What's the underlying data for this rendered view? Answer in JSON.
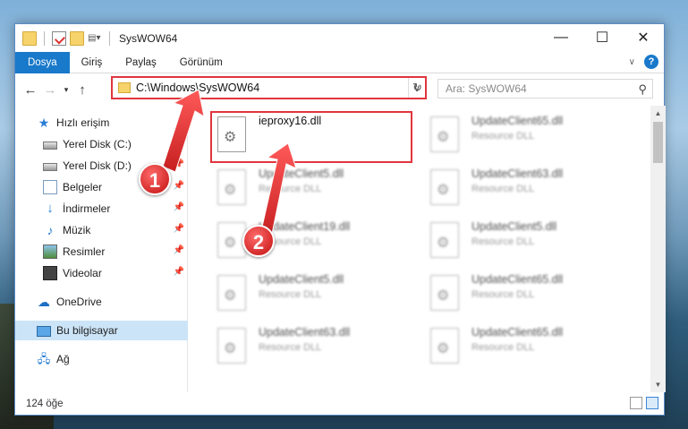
{
  "window": {
    "title": "SysWOW64",
    "controls": {
      "minimize": "—",
      "maximize": "☐",
      "close": "✕"
    }
  },
  "ribbon": {
    "tabs": [
      "Dosya",
      "Giriş",
      "Paylaş",
      "Görünüm"
    ]
  },
  "address": {
    "path": "C:\\Windows\\SysWOW64",
    "search_placeholder": "Ara: SysWOW64"
  },
  "sidebar": {
    "quick_access": "Hızlı erişim",
    "items": [
      {
        "label": "Yerel Disk (C:)",
        "icon": "disk-icon"
      },
      {
        "label": "Yerel Disk (D:)",
        "icon": "disk-icon"
      },
      {
        "label": "Belgeler",
        "icon": "documents-icon"
      },
      {
        "label": "İndirmeler",
        "icon": "download-icon"
      },
      {
        "label": "Müzik",
        "icon": "music-icon"
      },
      {
        "label": "Resimler",
        "icon": "pictures-icon"
      },
      {
        "label": "Videolar",
        "icon": "videos-icon"
      }
    ],
    "onedrive": "OneDrive",
    "this_pc": "Bu bilgisayar",
    "network": "Ağ"
  },
  "files": {
    "highlighted": {
      "name": "ieproxy16.dll"
    },
    "col1": [
      {
        "name": "UpdateClient5.dll",
        "type": "Resource DLL"
      },
      {
        "name": "UpdateClient19.dll",
        "type": "Resource DLL"
      },
      {
        "name": "UpdateClient5.dll",
        "type": "Resource DLL"
      },
      {
        "name": "UpdateClient63.dll",
        "type": "Resource DLL"
      }
    ],
    "col2": [
      {
        "name": "UpdateClient65.dll",
        "type": "Resource DLL"
      },
      {
        "name": "UpdateClient63.dll",
        "type": "Resource DLL"
      },
      {
        "name": "UpdateClient5.dll",
        "type": "Resource DLL"
      },
      {
        "name": "UpdateClient65.dll",
        "type": "Resource DLL"
      },
      {
        "name": "UpdateClient65.dll",
        "type": "Resource DLL"
      }
    ]
  },
  "status": {
    "count": "124 öğe"
  },
  "callouts": [
    "1",
    "2"
  ],
  "colors": {
    "accent": "#1979ca",
    "highlight": "#e0353f",
    "selected": "#cce4f7"
  }
}
